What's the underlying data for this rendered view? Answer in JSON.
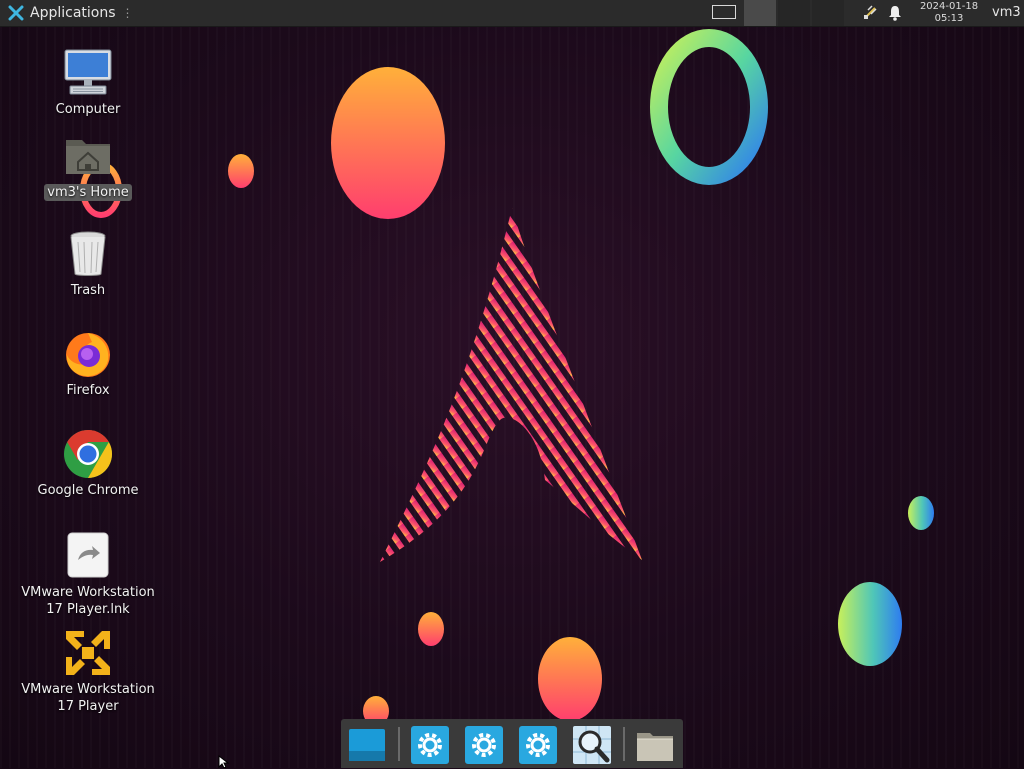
{
  "panel": {
    "applications_label": "Applications",
    "separator_glyph": "⋮",
    "clock_date": "2024-01-18",
    "clock_time": "05:13",
    "user": "vm3",
    "workspaces": 4,
    "tray_icons": [
      "network-icon",
      "bell-icon"
    ]
  },
  "desktop": {
    "icons": [
      {
        "label": "Computer",
        "icon": "computer-icon"
      },
      {
        "label": "vm3's Home",
        "icon": "home-folder-icon"
      },
      {
        "label": "Trash",
        "icon": "trash-icon"
      },
      {
        "label": "Firefox",
        "icon": "firefox-icon"
      },
      {
        "label": "Google Chrome",
        "icon": "chrome-icon"
      },
      {
        "label": "VMware Workstation 17 Player.lnk",
        "icon": "vmware-shortcut-icon"
      },
      {
        "label": "VMware Workstation 17 Player",
        "icon": "vmware-icon"
      }
    ]
  },
  "dock": {
    "items": [
      "show-desktop-icon",
      "settings-icon",
      "settings-icon",
      "settings-icon",
      "search-icon",
      "file-manager-icon"
    ]
  },
  "colors": {
    "panel": "#2b2b2b",
    "background": "#1c0a1b",
    "accent_pink": "#e0206a",
    "accent_orange": "#ff8a40",
    "dock": "#3a3a3a"
  }
}
